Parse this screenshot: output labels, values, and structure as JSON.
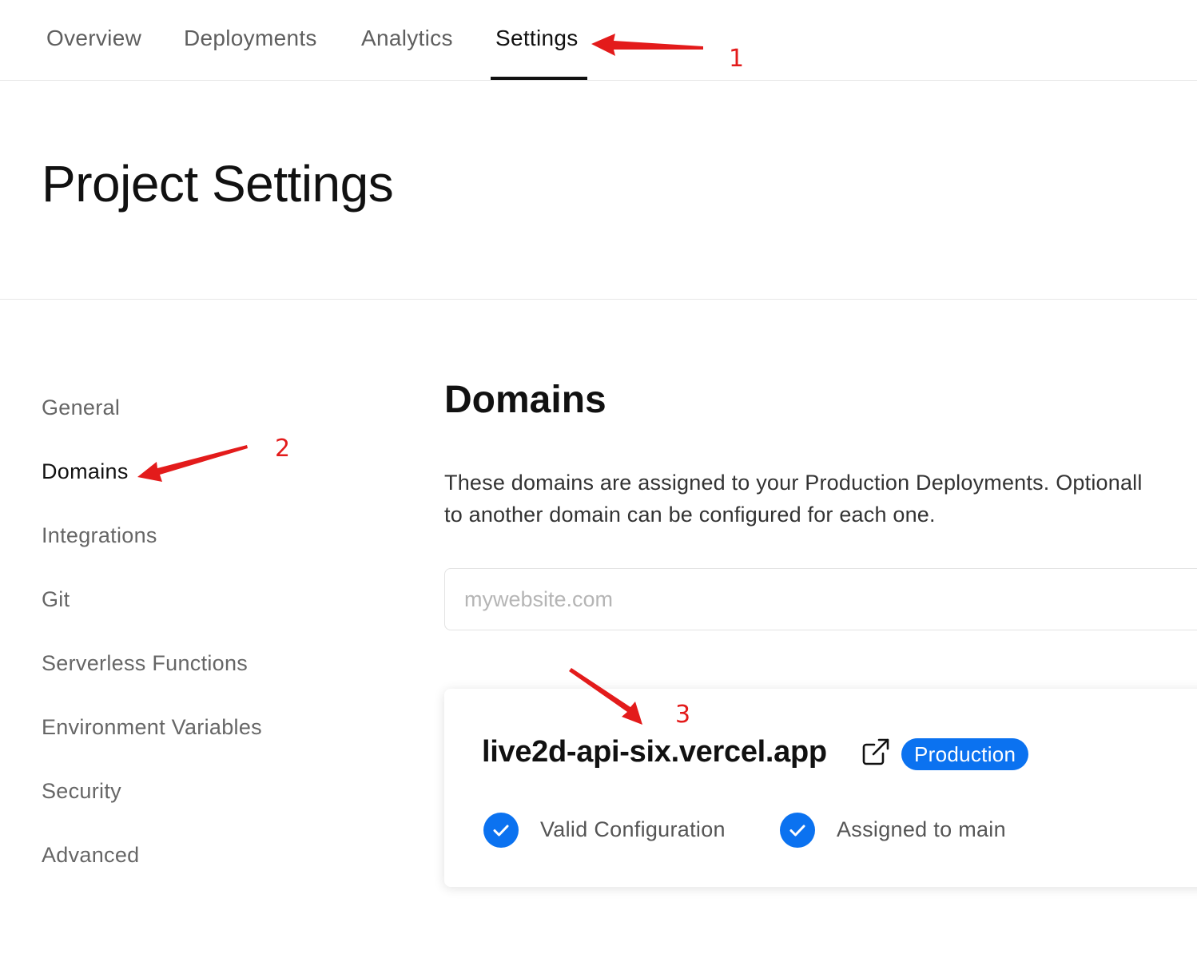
{
  "topnav": {
    "tabs": [
      {
        "label": "Overview"
      },
      {
        "label": "Deployments"
      },
      {
        "label": "Analytics"
      },
      {
        "label": "Settings"
      }
    ]
  },
  "header": {
    "title": "Project Settings"
  },
  "sidebar": {
    "items": [
      {
        "label": "General"
      },
      {
        "label": "Domains"
      },
      {
        "label": "Integrations"
      },
      {
        "label": "Git"
      },
      {
        "label": "Serverless Functions"
      },
      {
        "label": "Environment Variables"
      },
      {
        "label": "Security"
      },
      {
        "label": "Advanced"
      }
    ]
  },
  "main": {
    "title": "Domains",
    "description_line1": "These domains are assigned to your Production Deployments. Optionall",
    "description_line2": "to another domain can be configured for each one.",
    "input": {
      "placeholder": "mywebsite.com",
      "value": ""
    },
    "domain_card": {
      "domain": "live2d-api-six.vercel.app",
      "badge": "Production",
      "status_1": "Valid Configuration",
      "status_2": "Assigned to main"
    }
  },
  "annotations": [
    "1",
    "2",
    "3"
  ],
  "colors": {
    "accent": "#0b72f0",
    "annotation": "#e31b1b"
  }
}
